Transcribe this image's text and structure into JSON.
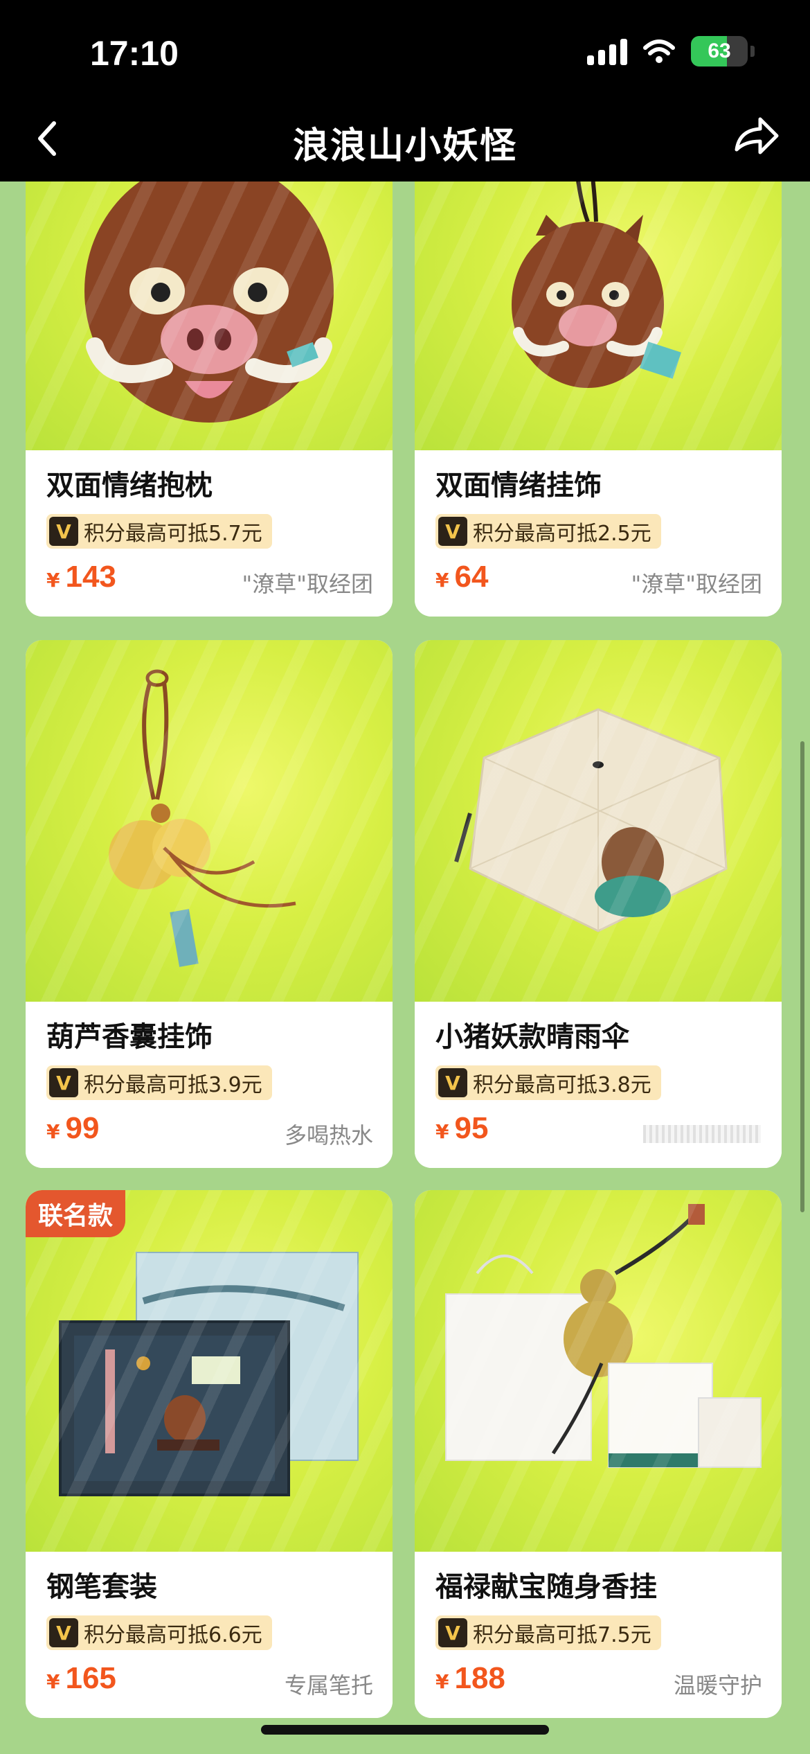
{
  "status_bar": {
    "time": "17:10",
    "battery": "63",
    "battery_level": 0.63
  },
  "nav": {
    "title": "浪浪山小妖怪",
    "back_icon": "chevron-left-icon",
    "share_icon": "share-arrow-icon"
  },
  "currency_symbol": "¥",
  "products": [
    {
      "name": "双面情绪抱枕",
      "points": "积分最高可抵5.7元",
      "price": "143",
      "tag": "\"潦草\"取经团",
      "image": "boar-face-pillow"
    },
    {
      "name": "双面情绪挂饰",
      "points": "积分最高可抵2.5元",
      "price": "64",
      "tag": "\"潦草\"取经团",
      "image": "boar-plush-keychain"
    },
    {
      "name": "葫芦香囊挂饰",
      "points": "积分最高可抵3.9元",
      "price": "99",
      "tag": "多喝热水",
      "image": "gourd-sachet-charm"
    },
    {
      "name": "小猪妖款晴雨伞",
      "points": "积分最高可抵3.8元",
      "price": "95",
      "tag": "",
      "image": "pig-demon-umbrella"
    },
    {
      "name": "钢笔套装",
      "points": "积分最高可抵6.6元",
      "price": "165",
      "tag": "专属笔托",
      "badge": "联名款",
      "image": "fountain-pen-set"
    },
    {
      "name": "福禄献宝随身香挂",
      "points": "积分最高可抵7.5元",
      "price": "188",
      "tag": "温暖守护",
      "image": "gourd-scent-pendant"
    }
  ],
  "colors": {
    "accent": "#f2561d",
    "badge": "#e4572e",
    "background": "#a7d58a",
    "points_bg": "#fbe7b9"
  }
}
